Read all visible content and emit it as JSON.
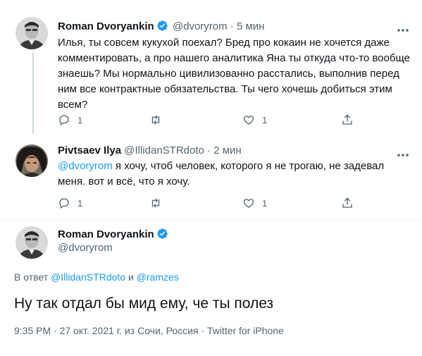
{
  "tweet1": {
    "name": "Roman Dvoryankin",
    "handle": "@dvoryrom",
    "dot": "·",
    "time": "5 мин",
    "lines": [
      "Илья, ты совсем кукухой поехал? Бред про кокаин не хочется даже",
      "комментировать, а про нашего аналитика Яна ты откуда что-то вообще",
      "знаешь? Мы нормально цивилизованно расстались, выполнив перед",
      "ним все контрактные обязательства. Ты чего хочешь добиться этим",
      "всем?"
    ],
    "reply_count": "1",
    "like_count": "1"
  },
  "tweet2": {
    "name": "Pivtsaev Ilya",
    "handle": "@IllidanSTRdoto",
    "dot": "·",
    "time": "2 мин",
    "mention": "@dvoryrom",
    "line1_rest": " я хочу, чтоб человек, которого я не трогаю, не задевал",
    "line2": "меня. вот и всё, что я хочу.",
    "reply_count": "1",
    "like_count": "1"
  },
  "tweet3": {
    "name": "Roman Dvoryankin",
    "handle": "@dvoryrom",
    "reply_prefix": "В ответ",
    "reply_to_1": "@IllidanSTRdoto",
    "reply_and": "и",
    "reply_to_2": "@ramzes",
    "text": "Ну так отдал бы мид ему, че ты полез",
    "meta": "9:35 PM · 27 окт. 2021 г. из Сочи, Россия · Twitter for iPhone"
  },
  "colors": {
    "accent": "#1d9bf0",
    "secondary_text": "#536471",
    "primary_text": "#0f1419"
  }
}
